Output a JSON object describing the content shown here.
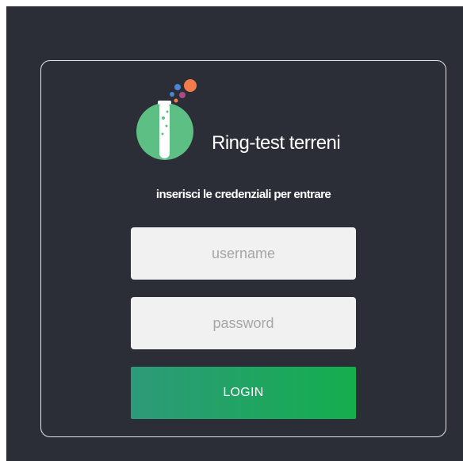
{
  "app": {
    "title": "Ring-test terreni",
    "logo_icon": "test-tube-icon"
  },
  "login": {
    "prompt": "inserisci le credenziali per entrare",
    "username_placeholder": "username",
    "password_placeholder": "password",
    "submit_label": "LOGIN"
  },
  "colors": {
    "background": "#2b2e36",
    "logo_circle": "#5dbf83",
    "button_gradient_start": "#2d9a79",
    "button_gradient_end": "#14ae4e",
    "bubble_orange": "#f47b4a",
    "bubble_blue": "#4a86d6",
    "bubble_purple": "#a94b86"
  }
}
